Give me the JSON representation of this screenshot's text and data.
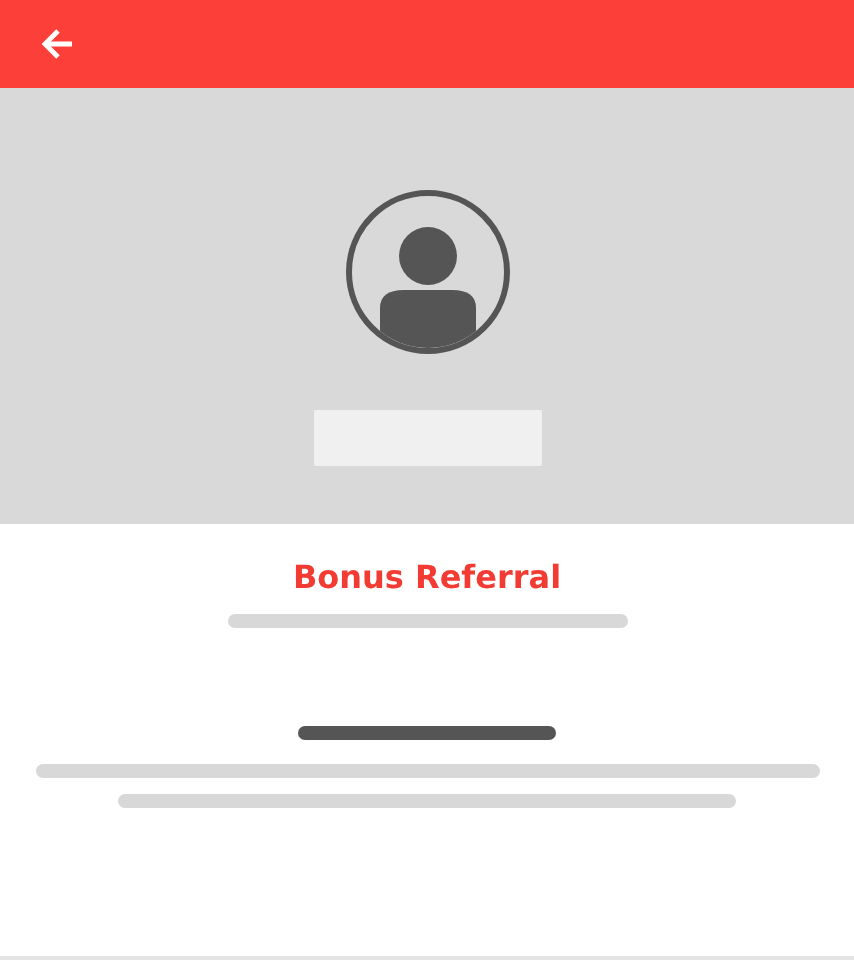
{
  "header": {
    "back_button": true
  },
  "referral": {
    "title": "Bonus Referral"
  }
}
